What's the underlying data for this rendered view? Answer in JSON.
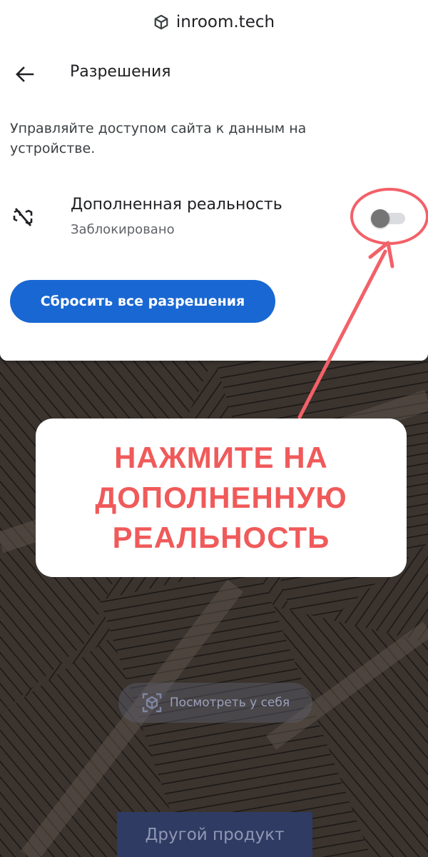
{
  "header": {
    "site_name": "inroom.tech",
    "site_icon": "cube-icon"
  },
  "sheet": {
    "title": "Разрешения",
    "description": "Управляйте доступом сайта к данным на устройстве."
  },
  "permission": {
    "label": "Дополненная реальность",
    "status": "Заблокировано",
    "icon": "ar-blocked-icon",
    "enabled": false
  },
  "reset_button": {
    "label": "Сбросить все разрешения"
  },
  "callout": {
    "lines": [
      "НАЖМИТЕ НА",
      "ДОПОЛНЕННУЮ",
      "РЕАЛЬНОСТЬ"
    ]
  },
  "background_page": {
    "ar_button_label": "Посмотреть у себя",
    "other_product_label": "Другой продукт"
  },
  "colors": {
    "accent": "#1967d2",
    "callout_text": "#f05a5a",
    "annotation": "#f26168"
  }
}
